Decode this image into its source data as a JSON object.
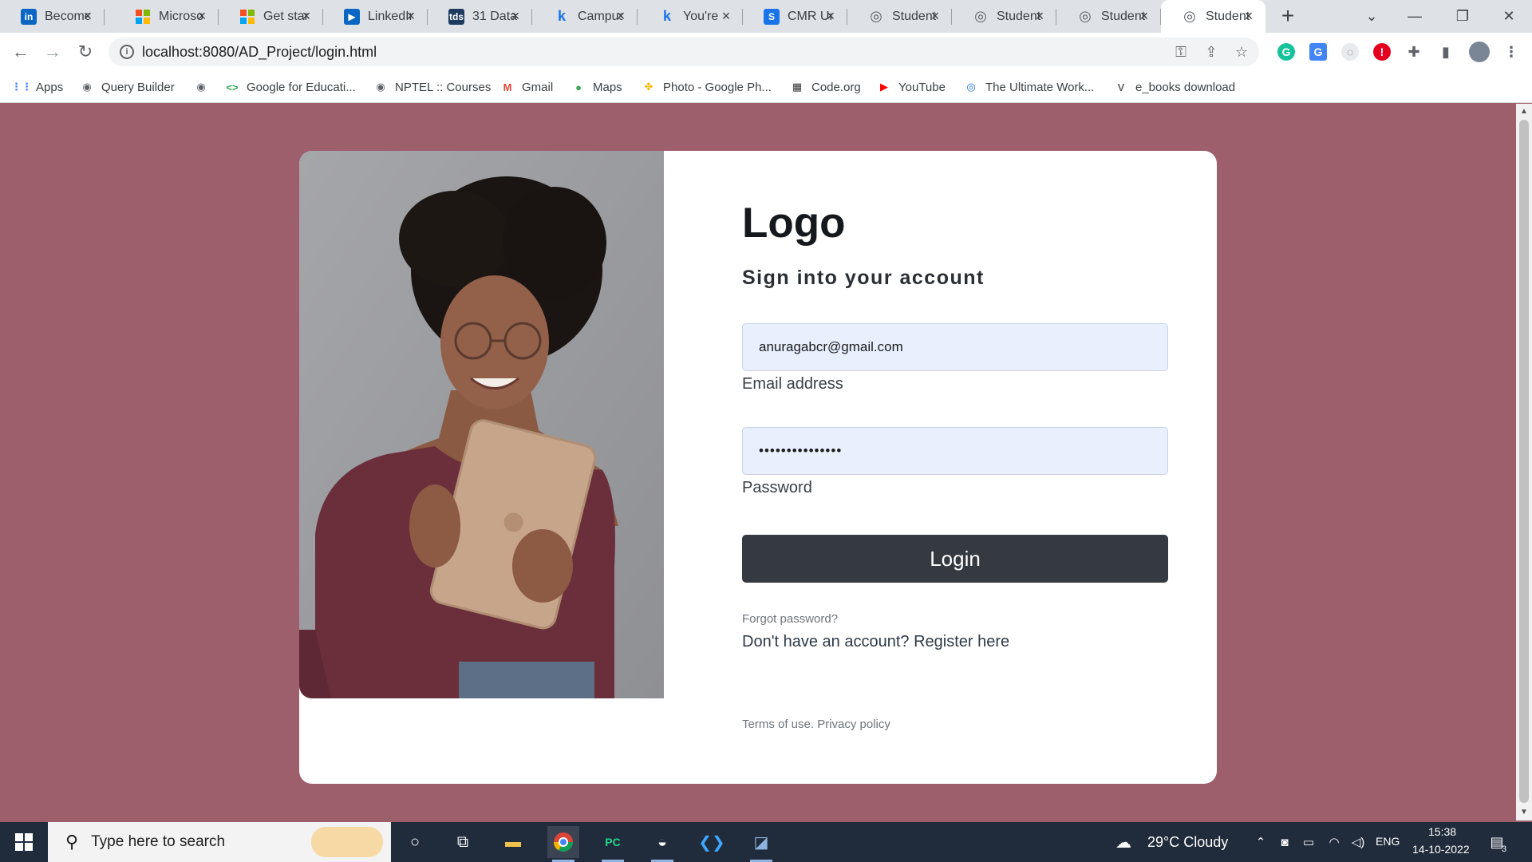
{
  "browser": {
    "tabs": [
      {
        "title": "Become",
        "icon": "linkedin-icon",
        "icon_text": "in",
        "icon_color": "#0a66c2"
      },
      {
        "title": "Microsoft",
        "icon": "microsoft-icon",
        "icon_text": "",
        "icon_color": "#f25022"
      },
      {
        "title": "Get started",
        "icon": "microsoft-icon",
        "icon_text": "",
        "icon_color": "#f25022"
      },
      {
        "title": "LinkedIn",
        "icon": "video-icon",
        "icon_text": "▶",
        "icon_color": "#0a66c2"
      },
      {
        "title": "31 Data",
        "icon": "tds-icon",
        "icon_text": "tds",
        "icon_color": "#1e3a5f"
      },
      {
        "title": "Campus",
        "icon": "k-icon",
        "icon_text": "k",
        "icon_color": "#1a73e8"
      },
      {
        "title": "You're",
        "icon": "k-icon",
        "icon_text": "k",
        "icon_color": "#1a73e8"
      },
      {
        "title": "CMR Un",
        "icon": "s-icon",
        "icon_text": "S",
        "icon_color": "#1a73e8"
      },
      {
        "title": "Student",
        "icon": "globe-icon",
        "icon_text": "◎",
        "icon_color": "#5f6368"
      },
      {
        "title": "Student",
        "icon": "globe-icon",
        "icon_text": "◎",
        "icon_color": "#5f6368"
      },
      {
        "title": "Student",
        "icon": "globe-icon",
        "icon_text": "◎",
        "icon_color": "#5f6368"
      },
      {
        "title": "Student",
        "icon": "globe-icon",
        "icon_text": "◎",
        "icon_color": "#5f6368"
      }
    ],
    "tab_close": "×",
    "new_tab": "+",
    "url": "localhost:8080/AD_Project/login.html",
    "bookmarks": [
      {
        "label": "Apps",
        "icon": "apps-grid-icon",
        "glyph": "⋮⋮",
        "color": "#4285f4"
      },
      {
        "label": "Query Builder",
        "icon": "globe-icon",
        "glyph": "◉",
        "color": "#5f6368"
      },
      {
        "label": "",
        "icon": "globe-icon",
        "glyph": "◉",
        "color": "#5f6368"
      },
      {
        "label": "Google for Educati...",
        "icon": "google-edu-icon",
        "glyph": "<>",
        "color": "#34a853"
      },
      {
        "label": "NPTEL :: Courses",
        "icon": "globe-icon",
        "glyph": "◉",
        "color": "#5f6368"
      },
      {
        "label": "Gmail",
        "icon": "gmail-icon",
        "glyph": "M",
        "color": "#ea4335"
      },
      {
        "label": "Maps",
        "icon": "maps-pin-icon",
        "glyph": "●",
        "color": "#34a853"
      },
      {
        "label": "Photo - Google Ph...",
        "icon": "photos-icon",
        "glyph": "✤",
        "color": "#fbbc05"
      },
      {
        "label": "Code.org",
        "icon": "code-org-icon",
        "glyph": "▦",
        "color": "#333333"
      },
      {
        "label": "YouTube",
        "icon": "youtube-icon",
        "glyph": "▶",
        "color": "#ff0000"
      },
      {
        "label": "The Ultimate Work...",
        "icon": "workout-icon",
        "glyph": "◎",
        "color": "#1a73e8"
      },
      {
        "label": "e_books download",
        "icon": "v-icon",
        "glyph": "V",
        "color": "#5f6368"
      }
    ]
  },
  "login": {
    "logo": "Logo",
    "subtitle": "Sign into your account",
    "email_value": "anuragabcr@gmail.com",
    "email_label": "Email address",
    "password_value": "•••••••••••••••",
    "password_label": "Password",
    "login_button": "Login",
    "forgot_password": "Forgot password?",
    "register_text": "Don't have an account? Register here",
    "terms": "Terms of use. Privacy policy"
  },
  "taskbar": {
    "search_placeholder": "Type here to search",
    "weather": "29°C  Cloudy",
    "language": "ENG",
    "time": "15:38",
    "date": "14-10-2022",
    "notification_count": "3"
  },
  "colors": {
    "page_background": "#9d5f6c",
    "button": "#353a40",
    "input_fill": "#e8f0fe"
  }
}
